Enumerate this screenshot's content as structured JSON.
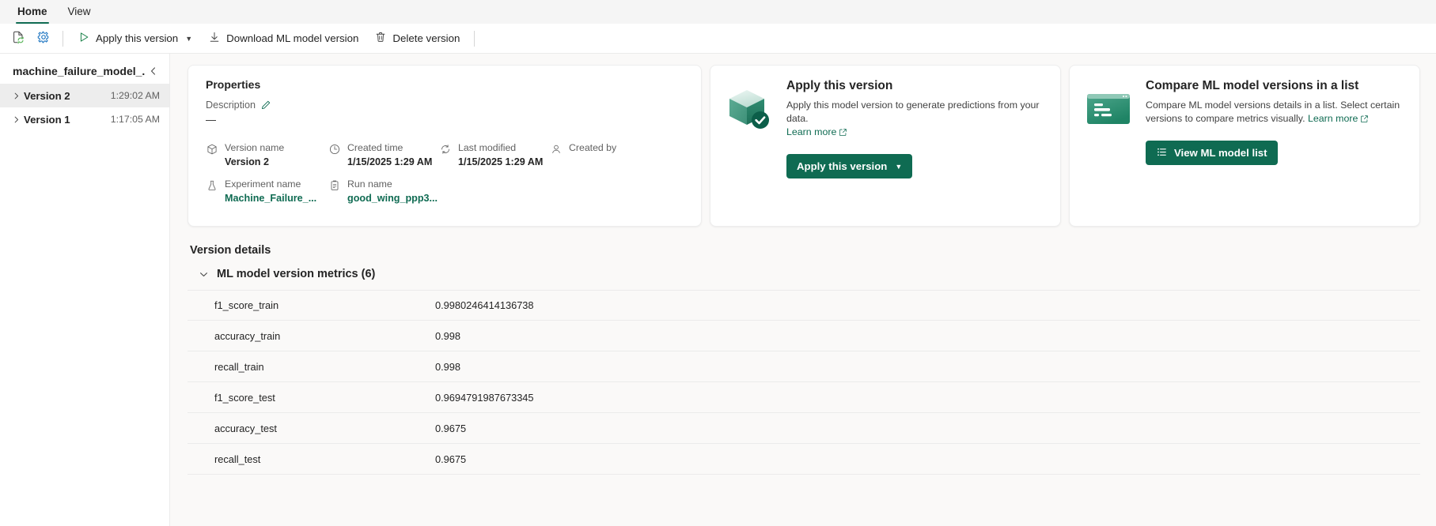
{
  "ribbon": {
    "tabs": [
      {
        "label": "Home",
        "active": true
      },
      {
        "label": "View",
        "active": false
      }
    ]
  },
  "commandbar": {
    "items": [
      {
        "name": "refresh-document",
        "label": "",
        "icon": "document-refresh-icon",
        "icon_only": true
      },
      {
        "name": "settings",
        "label": "",
        "icon": "gear-icon",
        "icon_only": true
      },
      {
        "name": "apply-this-version",
        "label": "Apply this version",
        "icon": "play-icon",
        "caret": true
      },
      {
        "name": "download-ml-model-version",
        "label": "Download ML model version",
        "icon": "download-icon"
      },
      {
        "name": "delete-version",
        "label": "Delete version",
        "icon": "trash-icon"
      }
    ]
  },
  "left_pane": {
    "title": "machine_failure_model_...",
    "collapse_icon": "chevron-left-icon",
    "items": [
      {
        "name": "Version 2",
        "time": "1:29:02 AM",
        "selected": true
      },
      {
        "name": "Version 1",
        "time": "1:17:05 AM",
        "selected": false
      }
    ]
  },
  "properties": {
    "title": "Properties",
    "description_label": "Description",
    "description_value": "—",
    "edit_icon": "pencil-icon",
    "fields": [
      {
        "icon": "cube-icon",
        "label": "Version name",
        "value": "Version 2",
        "link": false
      },
      {
        "icon": "clock-icon",
        "label": "Created time",
        "value": "1/15/2025 1:29 AM",
        "link": false
      },
      {
        "icon": "refresh-icon",
        "label": "Last modified",
        "value": "1/15/2025 1:29 AM",
        "link": false
      },
      {
        "icon": "person-icon",
        "label": "Created by",
        "value": "",
        "link": false
      },
      {
        "icon": "flask-icon",
        "label": "Experiment name",
        "value": "Machine_Failure_...",
        "link": true
      },
      {
        "icon": "clipboard-icon",
        "label": "Run name",
        "value": "good_wing_ppp3...",
        "link": true
      }
    ]
  },
  "apply_card": {
    "art_icon": "cube-check-illustration",
    "title": "Apply this version",
    "description": "Apply this model version to generate predictions from your data.",
    "learn_more": "Learn more",
    "learn_more_icon": "open-in-new-icon",
    "button_label": "Apply this version",
    "button_caret": "chevron-down-icon"
  },
  "compare_card": {
    "art_icon": "list-window-illustration",
    "title": "Compare ML model versions in a list",
    "description": "Compare ML model versions details in a list. Select certain versions to compare metrics visually.",
    "learn_more": "Learn more",
    "learn_more_icon": "open-in-new-icon",
    "button_label": "View ML model list",
    "button_icon": "list-icon"
  },
  "version_details": {
    "title": "Version details",
    "group_label": "ML model version metrics (6)",
    "group_chevron": "chevron-down-icon",
    "metrics": [
      {
        "key": "f1_score_train",
        "value": "0.9980246414136738"
      },
      {
        "key": "accuracy_train",
        "value": "0.998"
      },
      {
        "key": "recall_train",
        "value": "0.998"
      },
      {
        "key": "f1_score_test",
        "value": "0.9694791987673345"
      },
      {
        "key": "accuracy_test",
        "value": "0.9675"
      },
      {
        "key": "recall_test",
        "value": "0.9675"
      }
    ]
  },
  "colors": {
    "accent": "#0f6b52",
    "tab_underline": "#0f6b52",
    "selected_row": "#ededed"
  }
}
